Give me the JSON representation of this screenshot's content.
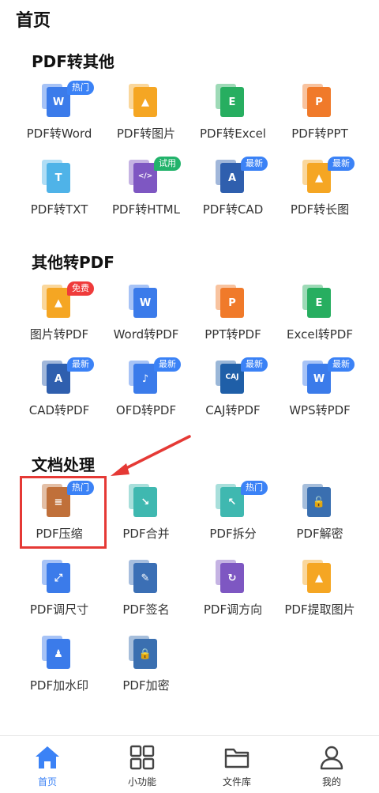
{
  "header": {
    "title": "首页"
  },
  "sections": [
    {
      "title": "PDF转其他",
      "items": [
        {
          "label": "PDF转Word",
          "glyph": "W",
          "color": "#3b7bea",
          "badge": "热门",
          "badge_color": "blue"
        },
        {
          "label": "PDF转图片",
          "glyph": "▲",
          "color": "#f5a623",
          "badge": "",
          "badge_color": ""
        },
        {
          "label": "PDF转Excel",
          "glyph": "E",
          "color": "#27ae60",
          "badge": "",
          "badge_color": ""
        },
        {
          "label": "PDF转PPT",
          "glyph": "P",
          "color": "#f07a2a",
          "badge": "",
          "badge_color": ""
        },
        {
          "label": "PDF转TXT",
          "glyph": "T",
          "color": "#4fb3e8",
          "badge": "",
          "badge_color": ""
        },
        {
          "label": "PDF转HTML",
          "glyph": "</>",
          "color": "#7e57c2",
          "badge": "试用",
          "badge_color": "green"
        },
        {
          "label": "PDF转CAD",
          "glyph": "A",
          "color": "#2f5fae",
          "badge": "最新",
          "badge_color": "blue"
        },
        {
          "label": "PDF转长图",
          "glyph": "▲",
          "color": "#f5a623",
          "badge": "最新",
          "badge_color": "blue"
        }
      ]
    },
    {
      "title": "其他转PDF",
      "items": [
        {
          "label": "图片转PDF",
          "glyph": "▲",
          "color": "#f5a623",
          "badge": "免费",
          "badge_color": "red"
        },
        {
          "label": "Word转PDF",
          "glyph": "W",
          "color": "#3b7bea",
          "badge": "",
          "badge_color": ""
        },
        {
          "label": "PPT转PDF",
          "glyph": "P",
          "color": "#f07a2a",
          "badge": "",
          "badge_color": ""
        },
        {
          "label": "Excel转PDF",
          "glyph": "E",
          "color": "#27ae60",
          "badge": "",
          "badge_color": ""
        },
        {
          "label": "CAD转PDF",
          "glyph": "A",
          "color": "#2f5fae",
          "badge": "最新",
          "badge_color": "blue"
        },
        {
          "label": "OFD转PDF",
          "glyph": "♪",
          "color": "#3b7bea",
          "badge": "最新",
          "badge_color": "blue"
        },
        {
          "label": "CAJ转PDF",
          "glyph": "CAJ",
          "color": "#1f5fa8",
          "badge": "最新",
          "badge_color": "blue"
        },
        {
          "label": "WPS转PDF",
          "glyph": "W",
          "color": "#3b7bea",
          "badge": "最新",
          "badge_color": "blue"
        }
      ]
    },
    {
      "title": "文档处理",
      "items": [
        {
          "label": "PDF压缩",
          "glyph": "≡",
          "color": "#c0703a",
          "badge": "热门",
          "badge_color": "blue"
        },
        {
          "label": "PDF合并",
          "glyph": "↘",
          "color": "#3fb8b0",
          "badge": "",
          "badge_color": ""
        },
        {
          "label": "PDF拆分",
          "glyph": "↖",
          "color": "#3fb8b0",
          "badge": "热门",
          "badge_color": "blue"
        },
        {
          "label": "PDF解密",
          "glyph": "🔓",
          "color": "#3a6fb0",
          "badge": "",
          "badge_color": ""
        },
        {
          "label": "PDF调尺寸",
          "glyph": "⤢",
          "color": "#3b7bea",
          "badge": "",
          "badge_color": ""
        },
        {
          "label": "PDF签名",
          "glyph": "✎",
          "color": "#3b6fb5",
          "badge": "",
          "badge_color": ""
        },
        {
          "label": "PDF调方向",
          "glyph": "↻",
          "color": "#7e57c2",
          "badge": "",
          "badge_color": ""
        },
        {
          "label": "PDF提取图片",
          "glyph": "▲",
          "color": "#f5a623",
          "badge": "",
          "badge_color": ""
        },
        {
          "label": "PDF加水印",
          "glyph": "♟",
          "color": "#3b7bea",
          "badge": "",
          "badge_color": ""
        },
        {
          "label": "PDF加密",
          "glyph": "🔒",
          "color": "#3a6fb0",
          "badge": "",
          "badge_color": ""
        }
      ]
    }
  ],
  "tabbar": [
    {
      "label": "首页",
      "icon": "home-icon",
      "active": true
    },
    {
      "label": "小功能",
      "icon": "grid-icon",
      "active": false
    },
    {
      "label": "文件库",
      "icon": "folder-icon",
      "active": false
    },
    {
      "label": "我的",
      "icon": "user-icon",
      "active": false
    }
  ],
  "colors": {
    "accent": "#3b82f6",
    "highlight": "#e53935"
  }
}
